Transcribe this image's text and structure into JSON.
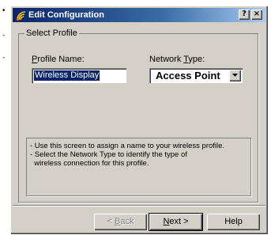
{
  "window": {
    "title": "Edit Configuration",
    "help_button": "?",
    "close_button": "×"
  },
  "background": {
    "bullets": [
      "•",
      "-",
      "-"
    ]
  },
  "select_profile": {
    "legend": "Select Profile",
    "profile_name_label_prefix": "",
    "profile_name_label_mnemonic": "P",
    "profile_name_label_suffix": "rofile Name:",
    "profile_name_value": "Wireless Display",
    "network_type_label_prefix": "Network ",
    "network_type_label_mnemonic": "T",
    "network_type_label_suffix": "ype:",
    "network_type_value": "Access Point"
  },
  "info": {
    "lines": [
      "- Use this screen to assign a name to your wireless profile.",
      "- Select the Network Type to identify the type of",
      "  wireless connection for this profile."
    ]
  },
  "buttons": {
    "back_mnemonic": "B",
    "back_prefix": "< ",
    "back_suffix": "ack",
    "next_mnemonic": "N",
    "next_suffix": "ext >",
    "help": "Help"
  },
  "colors": {
    "title_gradient_start": "#0a246a",
    "title_gradient_end": "#a6caf0",
    "face": "#d4d0c8",
    "selection": "#0a246a"
  }
}
